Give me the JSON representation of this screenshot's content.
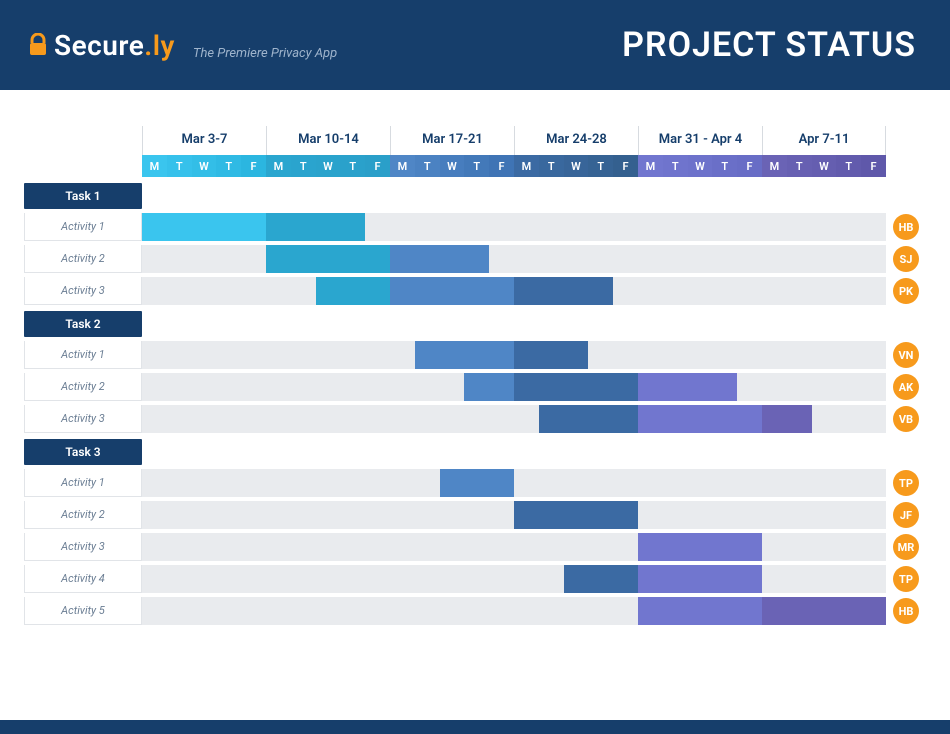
{
  "header": {
    "brand_name_a": "Secure",
    "brand_name_b": ".ly",
    "tagline": "The Premiere Privacy App",
    "title": "PROJECT STATUS"
  },
  "weeks": [
    {
      "label": "Mar 3-7",
      "color_start": "#3ac5ee",
      "color_end": "#2bb6e0"
    },
    {
      "label": "Mar 10-14",
      "color_start": "#2aa6cf",
      "color_end": "#2a9fc9"
    },
    {
      "label": "Mar 17-21",
      "color_start": "#4f86c6",
      "color_end": "#3f74b5"
    },
    {
      "label": "Mar 24-28",
      "color_start": "#3b6aa3",
      "color_end": "#34608f"
    },
    {
      "label": "Mar 31 - Apr 4",
      "color_start": "#7176cf",
      "color_end": "#686dc6"
    },
    {
      "label": "Apr 7-11",
      "color_start": "#6a63b5",
      "color_end": "#5f58aa"
    }
  ],
  "days": [
    "M",
    "T",
    "W",
    "T",
    "F"
  ],
  "tasks": [
    {
      "name": "Task 1",
      "activities": [
        {
          "label": "Activity 1",
          "assignee": "HB",
          "bars": [
            {
              "start": 1,
              "end": 5,
              "color": "#3ac5ee"
            },
            {
              "start": 6,
              "end": 9,
              "color": "#2aa6cf"
            }
          ]
        },
        {
          "label": "Activity 2",
          "assignee": "SJ",
          "bars": [
            {
              "start": 6,
              "end": 10,
              "color": "#2aa6cf"
            },
            {
              "start": 11,
              "end": 14,
              "color": "#4f86c6"
            }
          ]
        },
        {
          "label": "Activity 3",
          "assignee": "PK",
          "bars": [
            {
              "start": 8,
              "end": 10,
              "color": "#2aa6cf"
            },
            {
              "start": 11,
              "end": 15,
              "color": "#4f86c6"
            },
            {
              "start": 16,
              "end": 19,
              "color": "#3b6aa3"
            }
          ]
        }
      ]
    },
    {
      "name": "Task 2",
      "activities": [
        {
          "label": "Activity 1",
          "assignee": "VN",
          "bars": [
            {
              "start": 12,
              "end": 15,
              "color": "#4f86c6"
            },
            {
              "start": 16,
              "end": 18,
              "color": "#3b6aa3"
            }
          ]
        },
        {
          "label": "Activity 2",
          "assignee": "AK",
          "bars": [
            {
              "start": 14,
              "end": 15,
              "color": "#4f86c6"
            },
            {
              "start": 16,
              "end": 20,
              "color": "#3b6aa3"
            },
            {
              "start": 21,
              "end": 24,
              "color": "#7176cf"
            }
          ]
        },
        {
          "label": "Activity 3",
          "assignee": "VB",
          "bars": [
            {
              "start": 17,
              "end": 20,
              "color": "#3b6aa3"
            },
            {
              "start": 21,
              "end": 25,
              "color": "#7176cf"
            },
            {
              "start": 26,
              "end": 27,
              "color": "#6a63b5"
            }
          ]
        }
      ]
    },
    {
      "name": "Task 3",
      "activities": [
        {
          "label": "Activity 1",
          "assignee": "TP",
          "bars": [
            {
              "start": 13,
              "end": 15,
              "color": "#4f86c6"
            }
          ]
        },
        {
          "label": "Activity 2",
          "assignee": "JF",
          "bars": [
            {
              "start": 16,
              "end": 20,
              "color": "#3b6aa3"
            }
          ]
        },
        {
          "label": "Activity 3",
          "assignee": "MR",
          "bars": [
            {
              "start": 21,
              "end": 25,
              "color": "#7176cf"
            }
          ]
        },
        {
          "label": "Activity 4",
          "assignee": "TP",
          "bars": [
            {
              "start": 18,
              "end": 20,
              "color": "#3b6aa3"
            },
            {
              "start": 21,
              "end": 25,
              "color": "#7176cf"
            }
          ]
        },
        {
          "label": "Activity 5",
          "assignee": "HB",
          "bars": [
            {
              "start": 21,
              "end": 25,
              "color": "#7176cf"
            },
            {
              "start": 26,
              "end": 30,
              "color": "#6a63b5"
            }
          ]
        }
      ]
    }
  ],
  "chart_data": {
    "type": "gantt",
    "title": "PROJECT STATUS",
    "x_unit": "workday",
    "x_range": [
      1,
      30
    ],
    "week_labels": [
      "Mar 3-7",
      "Mar 10-14",
      "Mar 17-21",
      "Mar 24-28",
      "Mar 31 - Apr 4",
      "Apr 7-11"
    ],
    "day_labels": [
      "M",
      "T",
      "W",
      "T",
      "F"
    ],
    "series": [
      {
        "task": "Task 1",
        "activity": "Activity 1",
        "assignee": "HB",
        "segments": [
          [
            1,
            5
          ],
          [
            6,
            9
          ]
        ]
      },
      {
        "task": "Task 1",
        "activity": "Activity 2",
        "assignee": "SJ",
        "segments": [
          [
            6,
            10
          ],
          [
            11,
            14
          ]
        ]
      },
      {
        "task": "Task 1",
        "activity": "Activity 3",
        "assignee": "PK",
        "segments": [
          [
            8,
            10
          ],
          [
            11,
            15
          ],
          [
            16,
            19
          ]
        ]
      },
      {
        "task": "Task 2",
        "activity": "Activity 1",
        "assignee": "VN",
        "segments": [
          [
            12,
            15
          ],
          [
            16,
            18
          ]
        ]
      },
      {
        "task": "Task 2",
        "activity": "Activity 2",
        "assignee": "AK",
        "segments": [
          [
            14,
            15
          ],
          [
            16,
            20
          ],
          [
            21,
            24
          ]
        ]
      },
      {
        "task": "Task 2",
        "activity": "Activity 3",
        "assignee": "VB",
        "segments": [
          [
            17,
            20
          ],
          [
            21,
            25
          ],
          [
            26,
            27
          ]
        ]
      },
      {
        "task": "Task 3",
        "activity": "Activity 1",
        "assignee": "TP",
        "segments": [
          [
            13,
            15
          ]
        ]
      },
      {
        "task": "Task 3",
        "activity": "Activity 2",
        "assignee": "JF",
        "segments": [
          [
            16,
            20
          ]
        ]
      },
      {
        "task": "Task 3",
        "activity": "Activity 3",
        "assignee": "MR",
        "segments": [
          [
            21,
            25
          ]
        ]
      },
      {
        "task": "Task 3",
        "activity": "Activity 4",
        "assignee": "TP",
        "segments": [
          [
            18,
            20
          ],
          [
            21,
            25
          ]
        ]
      },
      {
        "task": "Task 3",
        "activity": "Activity 5",
        "assignee": "HB",
        "segments": [
          [
            21,
            25
          ],
          [
            26,
            30
          ]
        ]
      }
    ]
  }
}
